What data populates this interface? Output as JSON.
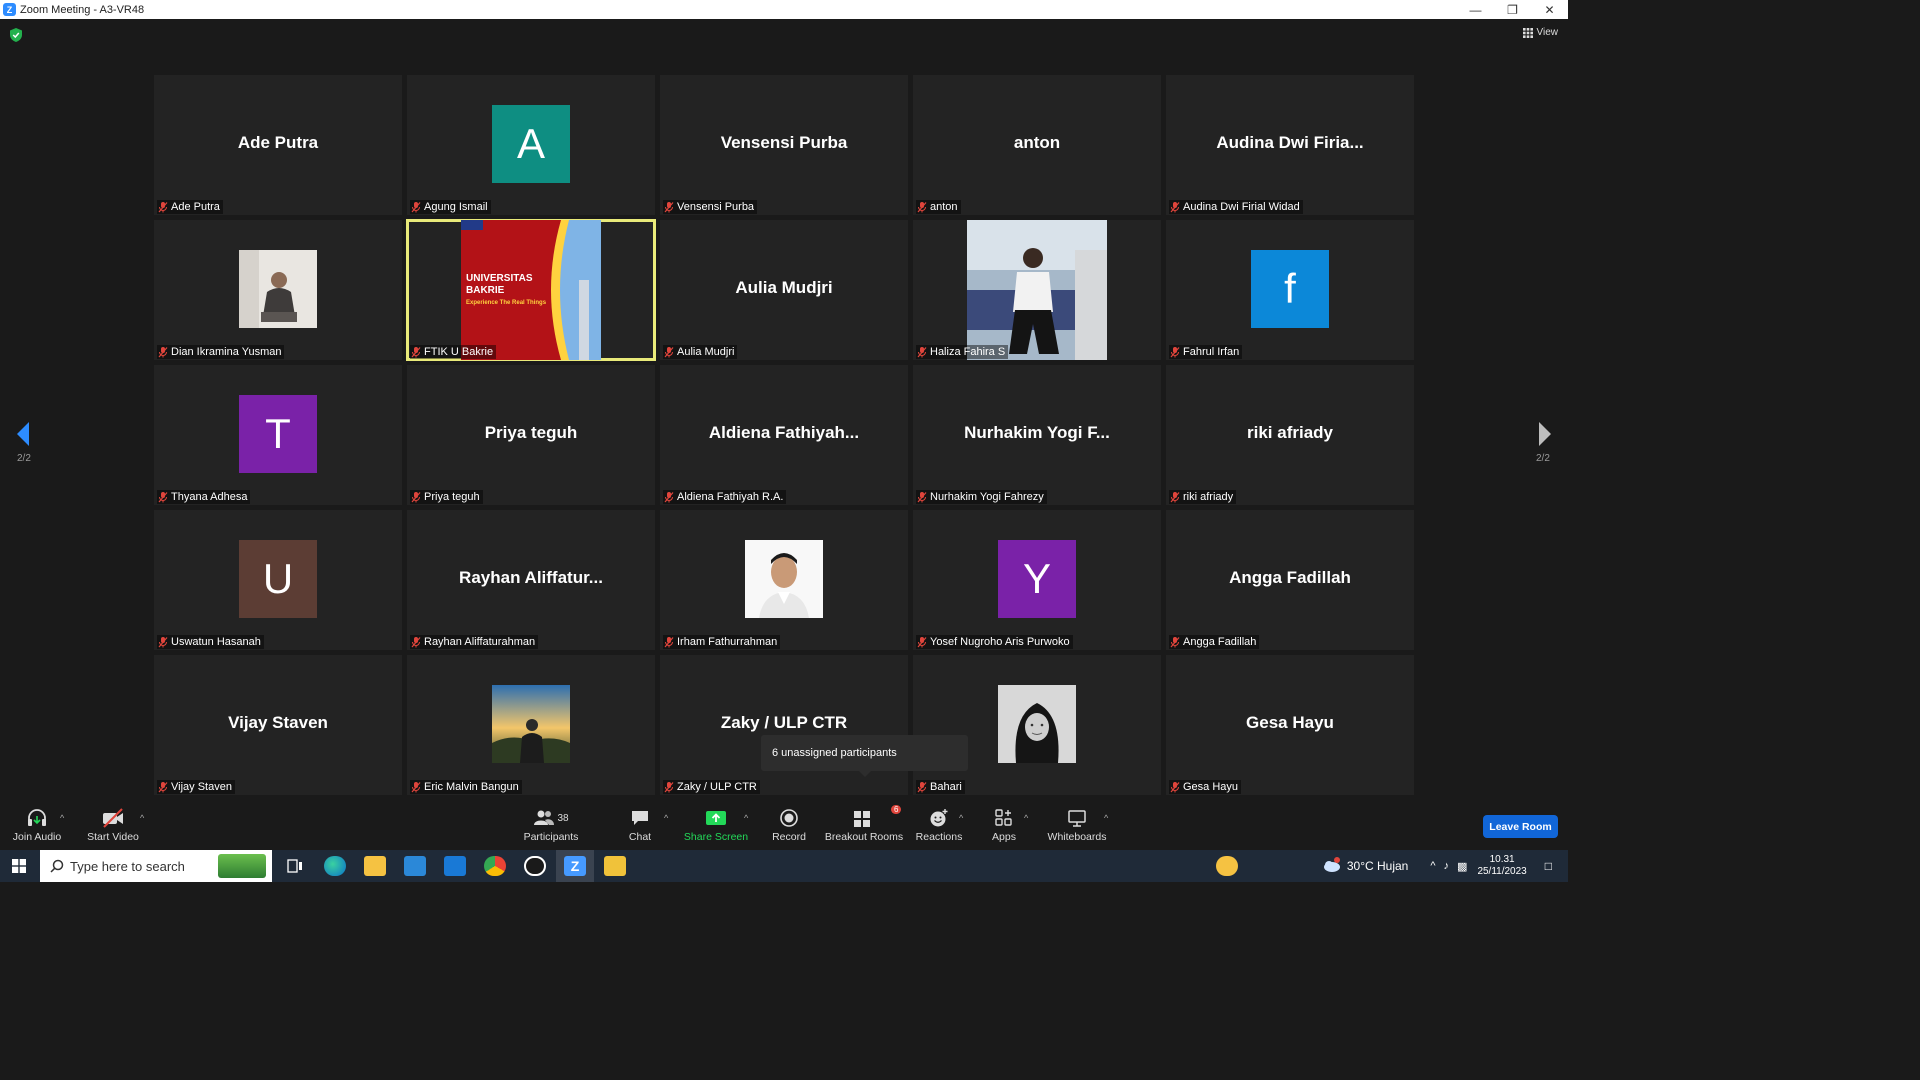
{
  "window": {
    "title": "Zoom Meeting - A3-VR48"
  },
  "view_label": "View",
  "page_indicator": {
    "left": "2/2",
    "right": "2/2"
  },
  "tiles": [
    {
      "kind": "name",
      "big": "Ade Putra",
      "label": "Ade Putra"
    },
    {
      "kind": "avatar",
      "letter": "A",
      "color": "#0e8e82",
      "label": "Agung Ismail"
    },
    {
      "kind": "name",
      "big": "Vensensi Purba",
      "label": "Vensensi Purba"
    },
    {
      "kind": "name",
      "big": "anton",
      "label": "anton"
    },
    {
      "kind": "name",
      "big": "Audina  Dwi  Firia...",
      "label": "Audina Dwi Firial Widad"
    },
    {
      "kind": "photo",
      "photo": "woman-seated",
      "label": "Dian Ikramina Yusman"
    },
    {
      "kind": "slide",
      "slide_title": "UNIVERSITAS\nBAKRIE",
      "slide_sub": "Experience The Real Things",
      "label": "FTIK U Bakrie",
      "active": true
    },
    {
      "kind": "name",
      "big": "Aulia Mudjri",
      "label": "Aulia Mudjri"
    },
    {
      "kind": "photo",
      "photo": "woman-uniform",
      "label": "Haliza Fahira S"
    },
    {
      "kind": "avatar",
      "letter": "f",
      "color": "#0c88d8",
      "label": "Fahrul Irfan"
    },
    {
      "kind": "avatar",
      "letter": "T",
      "color": "#7a22a8",
      "label": "Thyana Adhesa"
    },
    {
      "kind": "name",
      "big": "Priya teguh",
      "label": "Priya teguh"
    },
    {
      "kind": "name",
      "big": "Aldiena  Fathiyah...",
      "label": "Aldiena Fathiyah R.A."
    },
    {
      "kind": "name",
      "big": "Nurhakim  Yogi  F...",
      "label": "Nurhakim Yogi Fahrezy"
    },
    {
      "kind": "name",
      "big": "riki afriady",
      "label": "riki afriady"
    },
    {
      "kind": "avatar",
      "letter": "U",
      "color": "#5c3d34",
      "label": "Uswatun Hasanah"
    },
    {
      "kind": "name",
      "big": "Rayhan  Aliffatur...",
      "label": "Rayhan Aliffaturahman"
    },
    {
      "kind": "photo",
      "photo": "man-portrait",
      "label": "Irham Fathurrahman"
    },
    {
      "kind": "avatar",
      "letter": "Y",
      "color": "#7a22a8",
      "label": "Yosef Nugroho Aris Purwoko"
    },
    {
      "kind": "name",
      "big": "Angga Fadillah",
      "label": "Angga Fadillah"
    },
    {
      "kind": "name",
      "big": "Vijay Staven",
      "label": "Vijay Staven"
    },
    {
      "kind": "photo",
      "photo": "sunset-man",
      "label": "Eric Malvin Bangun"
    },
    {
      "kind": "name",
      "big": "Zaky / ULP CTR",
      "label": "Zaky / ULP CTR"
    },
    {
      "kind": "photo",
      "photo": "hijab-bw",
      "label": "Bahari"
    },
    {
      "kind": "name",
      "big": "Gesa Hayu",
      "label": "Gesa Hayu"
    }
  ],
  "tooltip": "6 unassigned participants",
  "toolbar": {
    "join_audio": "Join Audio",
    "start_video": "Start Video",
    "participants": "Participants",
    "participants_count": "38",
    "chat": "Chat",
    "share_screen": "Share Screen",
    "record": "Record",
    "breakout_rooms": "Breakout Rooms",
    "breakout_badge": "6",
    "reactions": "Reactions",
    "apps": "Apps",
    "whiteboards": "Whiteboards",
    "leave": "Leave Room"
  },
  "colors": {
    "accent": "#2d8cff",
    "share_green": "#23d959",
    "leave_blue": "#1166d8",
    "active_border": "#e9ea7a",
    "mute_red": "#e0453c"
  },
  "taskbar": {
    "search_placeholder": "Type here to search",
    "weather": "30°C  Hujan",
    "weather_badge": "1",
    "time": "10.31",
    "date": "25/11/2023"
  }
}
